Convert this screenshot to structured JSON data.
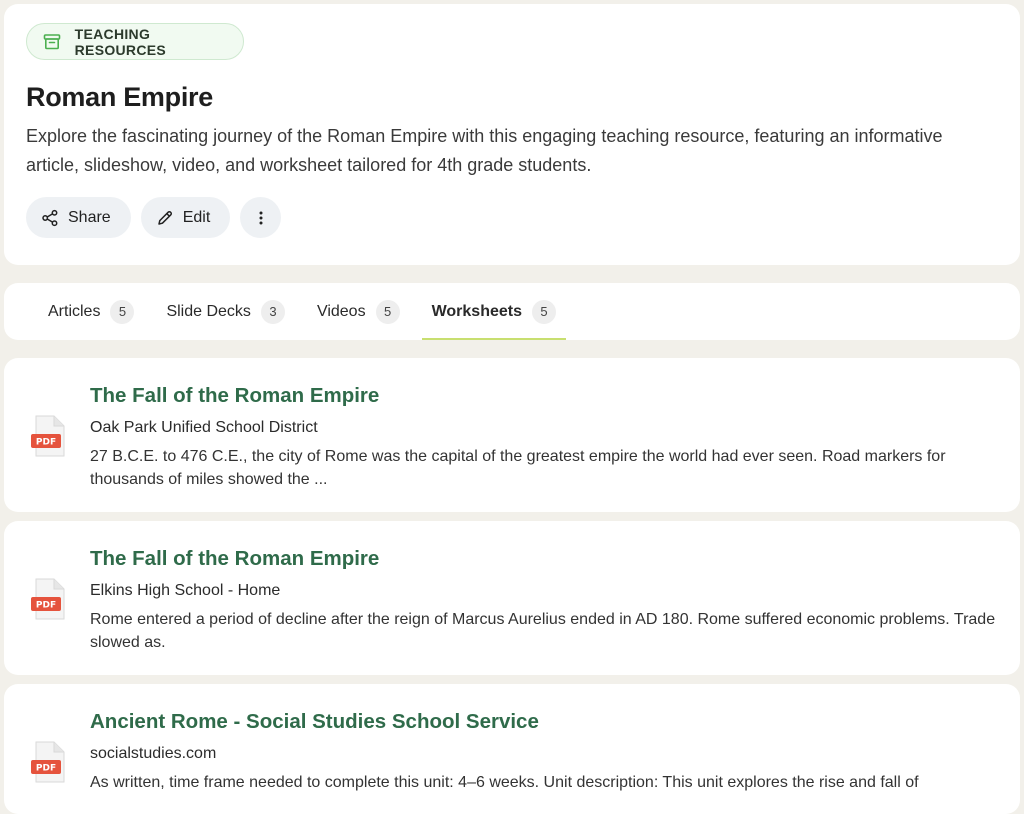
{
  "header": {
    "badge": {
      "icon": "archive-box-icon",
      "label": "TEACHING RESOURCES"
    },
    "title": "Roman Empire",
    "description": "Explore the fascinating journey of the Roman Empire with this engaging teaching resource, featuring an informative article, slideshow, video, and worksheet tailored for 4th grade students.",
    "actions": {
      "share_label": "Share",
      "edit_label": "Edit",
      "more_icon": "more-vertical-icon"
    }
  },
  "tabs": [
    {
      "label": "Articles",
      "count": "5"
    },
    {
      "label": "Slide Decks",
      "count": "3"
    },
    {
      "label": "Videos",
      "count": "5"
    },
    {
      "label": "Worksheets",
      "count": "5",
      "active": true
    }
  ],
  "results": [
    {
      "title": "The Fall of the Roman Empire",
      "source": "Oak Park Unified School District",
      "snippet": "27 B.C.E. to 476 C.E., the city of Rome was the capital of the greatest empire the world had ever seen. Road markers for thousands of miles showed the ...",
      "file_type": "PDF"
    },
    {
      "title": "The Fall of the Roman Empire",
      "source": "Elkins High School - Home",
      "snippet": "Rome entered a period of decline after the reign of Marcus Aurelius ended in AD 180. Rome suffered economic problems. Trade slowed as.",
      "file_type": "PDF"
    },
    {
      "title": "Ancient Rome - Social Studies School Service",
      "source": "socialstudies.com",
      "snippet": "As written, time frame needed to complete this unit: 4–6 weeks. Unit description: This unit explores the rise and fall of",
      "file_type": "PDF"
    }
  ],
  "colors": {
    "background": "#f2f0ea",
    "badge_green": "#4caf50",
    "title_green": "#2f6b4a",
    "tab_underline": "#c8df70",
    "pdf_red": "#e5533d"
  }
}
